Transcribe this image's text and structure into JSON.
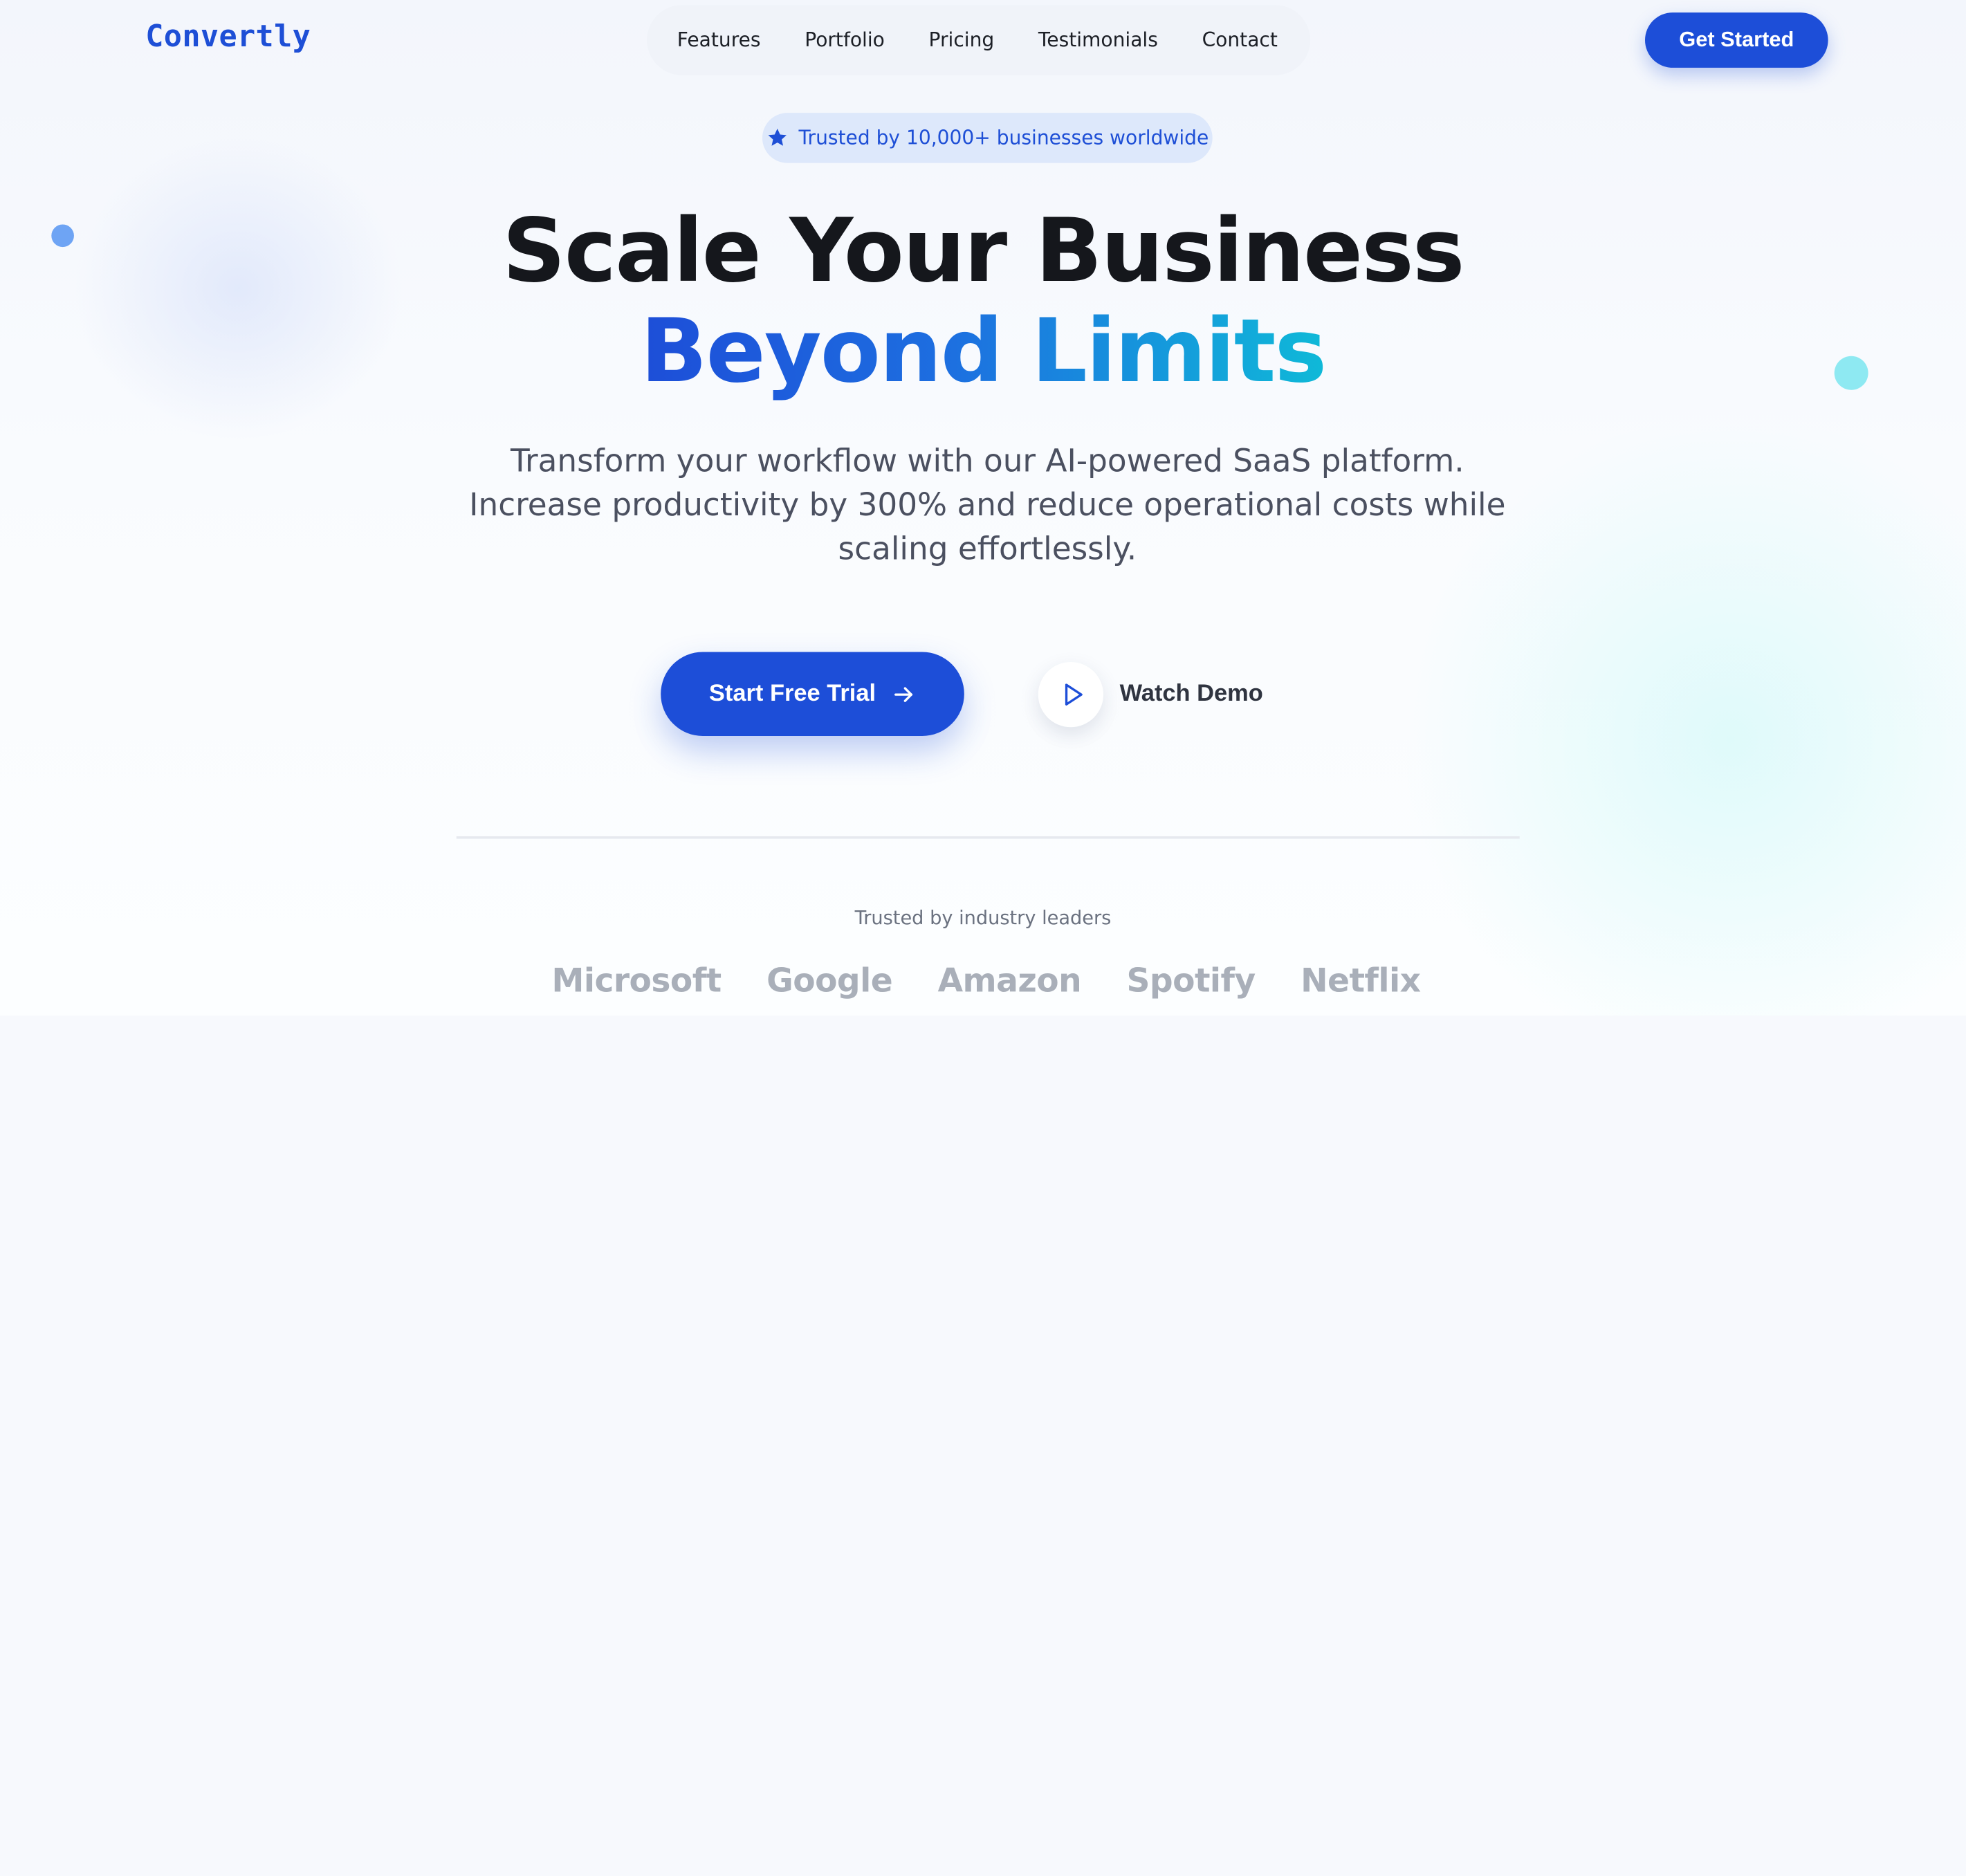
{
  "brand": {
    "logo": "Convertly",
    "accent_color": "#1d4ed8",
    "gradient_end_color": "#06b6d4"
  },
  "nav": {
    "items": [
      "Features",
      "Portfolio",
      "Pricing",
      "Testimonials",
      "Contact"
    ]
  },
  "header": {
    "cta_label": "Get Started"
  },
  "hero": {
    "badge_icon": "star-icon",
    "badge_text": "Trusted by 10,000+ businesses worldwide",
    "headline_line1": "Scale Your Business",
    "headline_line2": "Beyond Limits",
    "subtitle": "Transform your workflow with our AI-powered SaaS platform. Increase productivity by 300% and reduce operational costs while scaling effortlessly.",
    "primary_cta": {
      "label": "Start Free Trial",
      "icon": "arrow-right-icon"
    },
    "secondary_cta": {
      "label": "Watch Demo",
      "icon": "play-icon"
    }
  },
  "trusted": {
    "label": "Trusted by industry leaders",
    "logos": [
      "Microsoft",
      "Google",
      "Amazon",
      "Spotify",
      "Netflix"
    ]
  }
}
